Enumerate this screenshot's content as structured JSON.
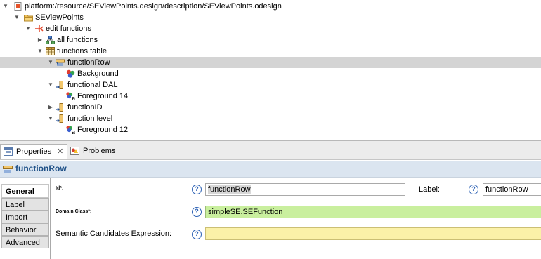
{
  "tree": {
    "rows": [
      {
        "label": "platform:/resource/SEViewPoints.design/description/SEViewPoints.odesign",
        "icon": "odesign-file-icon"
      },
      {
        "label": "SEViewPoints",
        "icon": "folder-icon"
      },
      {
        "label": "edit functions",
        "icon": "viewpoint-icon"
      },
      {
        "label": "all functions",
        "icon": "diagram-icon"
      },
      {
        "label": "functions table",
        "icon": "table-icon"
      },
      {
        "label": "functionRow",
        "icon": "line-mapping-icon"
      },
      {
        "label": "Background",
        "icon": "background-style-icon"
      },
      {
        "label": "functional DAL",
        "icon": "column-mapping-icon"
      },
      {
        "label": "Foreground 14",
        "icon": "foreground-style-icon"
      },
      {
        "label": "functionID",
        "icon": "column-mapping-icon"
      },
      {
        "label": "function level",
        "icon": "column-mapping-icon"
      },
      {
        "label": "Foreground 12",
        "icon": "foreground-style-icon"
      }
    ]
  },
  "view_tabs": {
    "properties": "Properties",
    "close_glyph": "✕",
    "problems": "Problems"
  },
  "header": {
    "title": "functionRow"
  },
  "categories": [
    "General",
    "Label",
    "Import",
    "Behavior",
    "Advanced"
  ],
  "form": {
    "id_label": "Id*:",
    "id_value": "functionRow",
    "label_label": "Label:",
    "label_value": "functionRow",
    "domain_class_label": "Domain Class*:",
    "domain_class_value": "simpleSE.SEFunction",
    "semantic_label": "Semantic Candidates Expression:",
    "semantic_value": "",
    "help_glyph": "?"
  },
  "colors": {
    "selection": "#d4d4d4",
    "header_bg": "#dbe5f0",
    "header_text": "#1d4f86",
    "required_green": "#c9ef9e",
    "expression_yellow": "#fbf1a8"
  }
}
